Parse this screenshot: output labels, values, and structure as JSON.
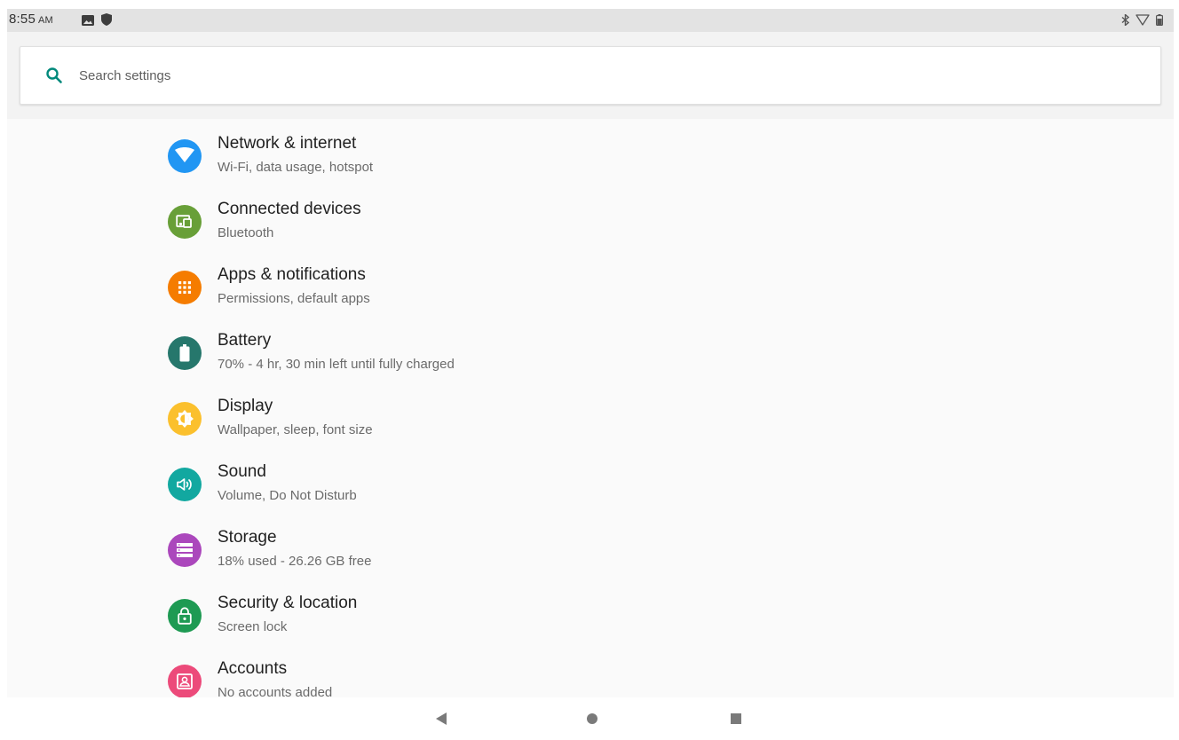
{
  "status_bar": {
    "time": "8:55",
    "ampm": "AM",
    "left_icons": [
      "image-icon",
      "shield-icon"
    ],
    "right_icons": [
      "bluetooth-icon",
      "wifi-icon",
      "battery-icon"
    ]
  },
  "search": {
    "placeholder": "Search settings",
    "icon": "search-icon",
    "accent_color": "#00897b"
  },
  "settings": [
    {
      "key": "network",
      "title": "Network & internet",
      "summary": "Wi-Fi, data usage, hotspot",
      "icon": "wifi-icon",
      "color": "#2196f3"
    },
    {
      "key": "connected-devices",
      "title": "Connected devices",
      "summary": "Bluetooth",
      "icon": "devices-icon",
      "color": "#689f38"
    },
    {
      "key": "apps",
      "title": "Apps & notifications",
      "summary": "Permissions, default apps",
      "icon": "apps-grid-icon",
      "color": "#f57c00"
    },
    {
      "key": "battery",
      "title": "Battery",
      "summary": "70% - 4 hr, 30 min left until fully charged",
      "icon": "battery-icon",
      "color": "#26776c"
    },
    {
      "key": "display",
      "title": "Display",
      "summary": "Wallpaper, sleep, font size",
      "icon": "brightness-icon",
      "color": "#fbc02d"
    },
    {
      "key": "sound",
      "title": "Sound",
      "summary": "Volume, Do Not Disturb",
      "icon": "volume-icon",
      "color": "#12a8a0"
    },
    {
      "key": "storage",
      "title": "Storage",
      "summary": "18% used - 26.26 GB free",
      "icon": "storage-icon",
      "color": "#ab47bc"
    },
    {
      "key": "security",
      "title": "Security & location",
      "summary": "Screen lock",
      "icon": "lock-icon",
      "color": "#1e9a53"
    },
    {
      "key": "accounts",
      "title": "Accounts",
      "summary": "No accounts added",
      "icon": "account-icon",
      "color": "#ec4a7a"
    }
  ],
  "nav_bar": {
    "buttons": [
      "back-icon",
      "home-icon",
      "recents-icon"
    ]
  }
}
